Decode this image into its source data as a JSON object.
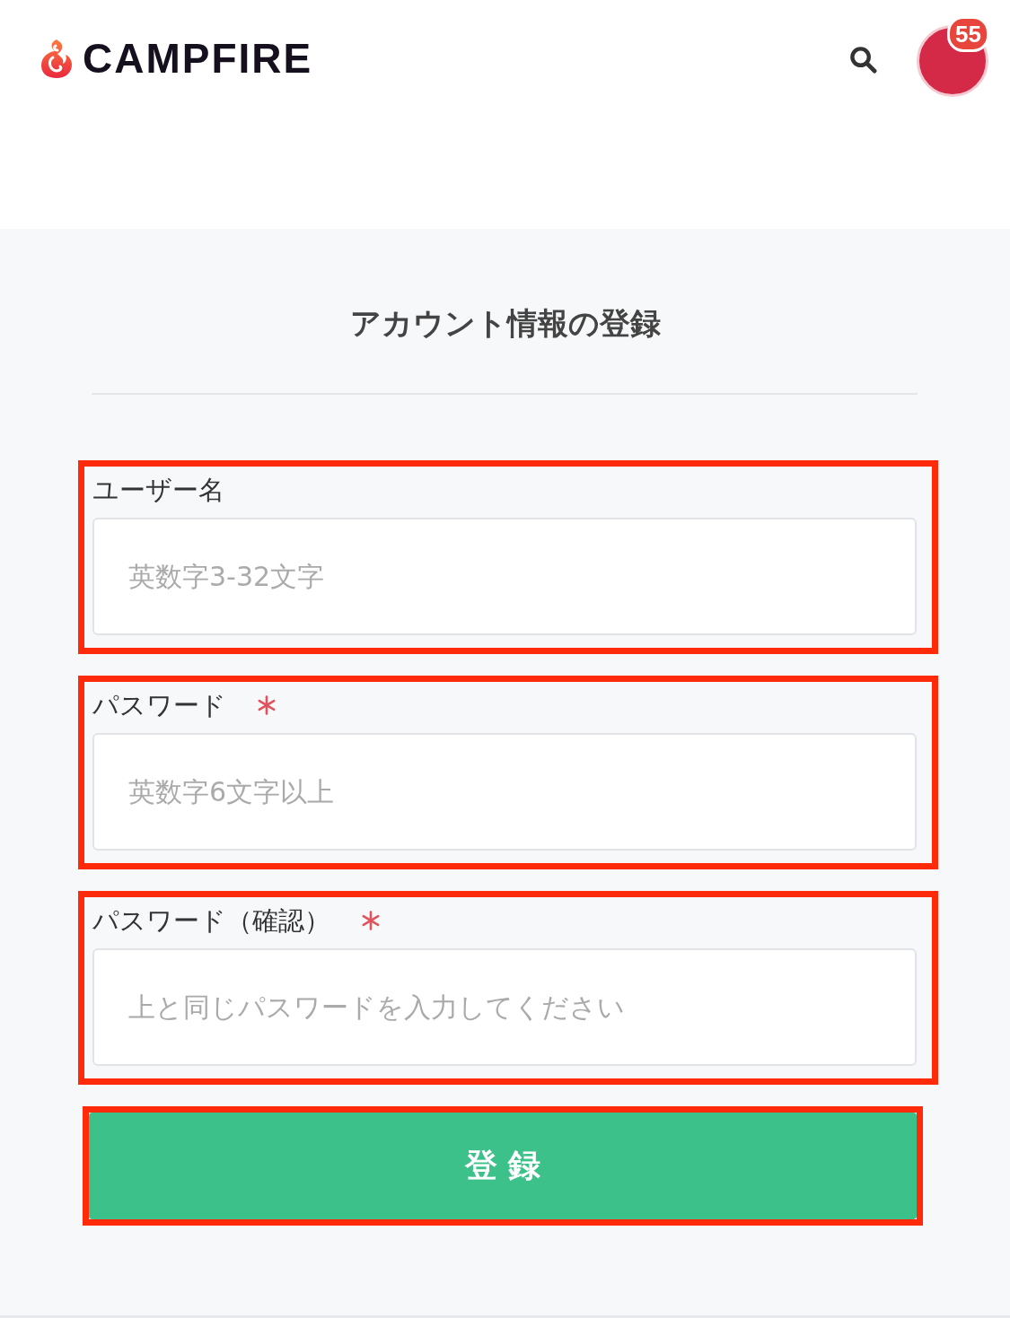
{
  "header": {
    "logo": "CAMPFIRE",
    "notification_count": "55"
  },
  "form": {
    "title": "アカウント情報の登録",
    "fields": [
      {
        "label": "ユーザー名",
        "required": false,
        "placeholder": "英数字3-32文字",
        "highlighted": true
      },
      {
        "label": "パスワード",
        "required": true,
        "placeholder": "英数字6文字以上",
        "highlighted": true
      },
      {
        "label": "パスワード（確認）",
        "required": true,
        "placeholder": "上と同じパスワードを入力してください",
        "highlighted": true
      }
    ],
    "submit": {
      "label": "登録",
      "highlighted": true
    }
  }
}
